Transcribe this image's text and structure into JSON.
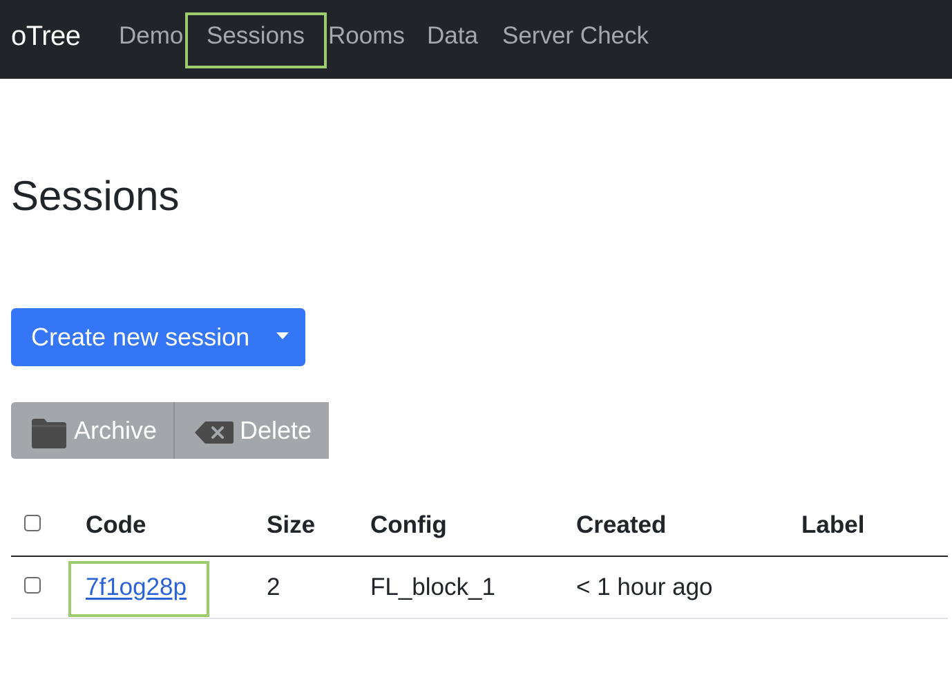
{
  "nav": {
    "brand": "oTree",
    "links": [
      "Demo",
      "Sessions",
      "Rooms",
      "Data",
      "Server Check"
    ]
  },
  "page": {
    "title": "Sessions"
  },
  "create_session": {
    "label": "Create new session"
  },
  "actions": {
    "archive_label": "Archive",
    "delete_label": "Delete"
  },
  "table": {
    "headers": {
      "code": "Code",
      "size": "Size",
      "config": "Config",
      "created": "Created",
      "label": "Label"
    },
    "rows": [
      {
        "code": "7f1og28p",
        "size": "2",
        "config": "FL_block_1",
        "created": "< 1 hour ago",
        "label": ""
      }
    ]
  },
  "colors": {
    "navbar_bg": "#212529",
    "primary_button": "#3476f6",
    "secondary_button": "#a3a7ab",
    "highlight_outline": "#9ccc6e",
    "link": "#2a63d8"
  }
}
